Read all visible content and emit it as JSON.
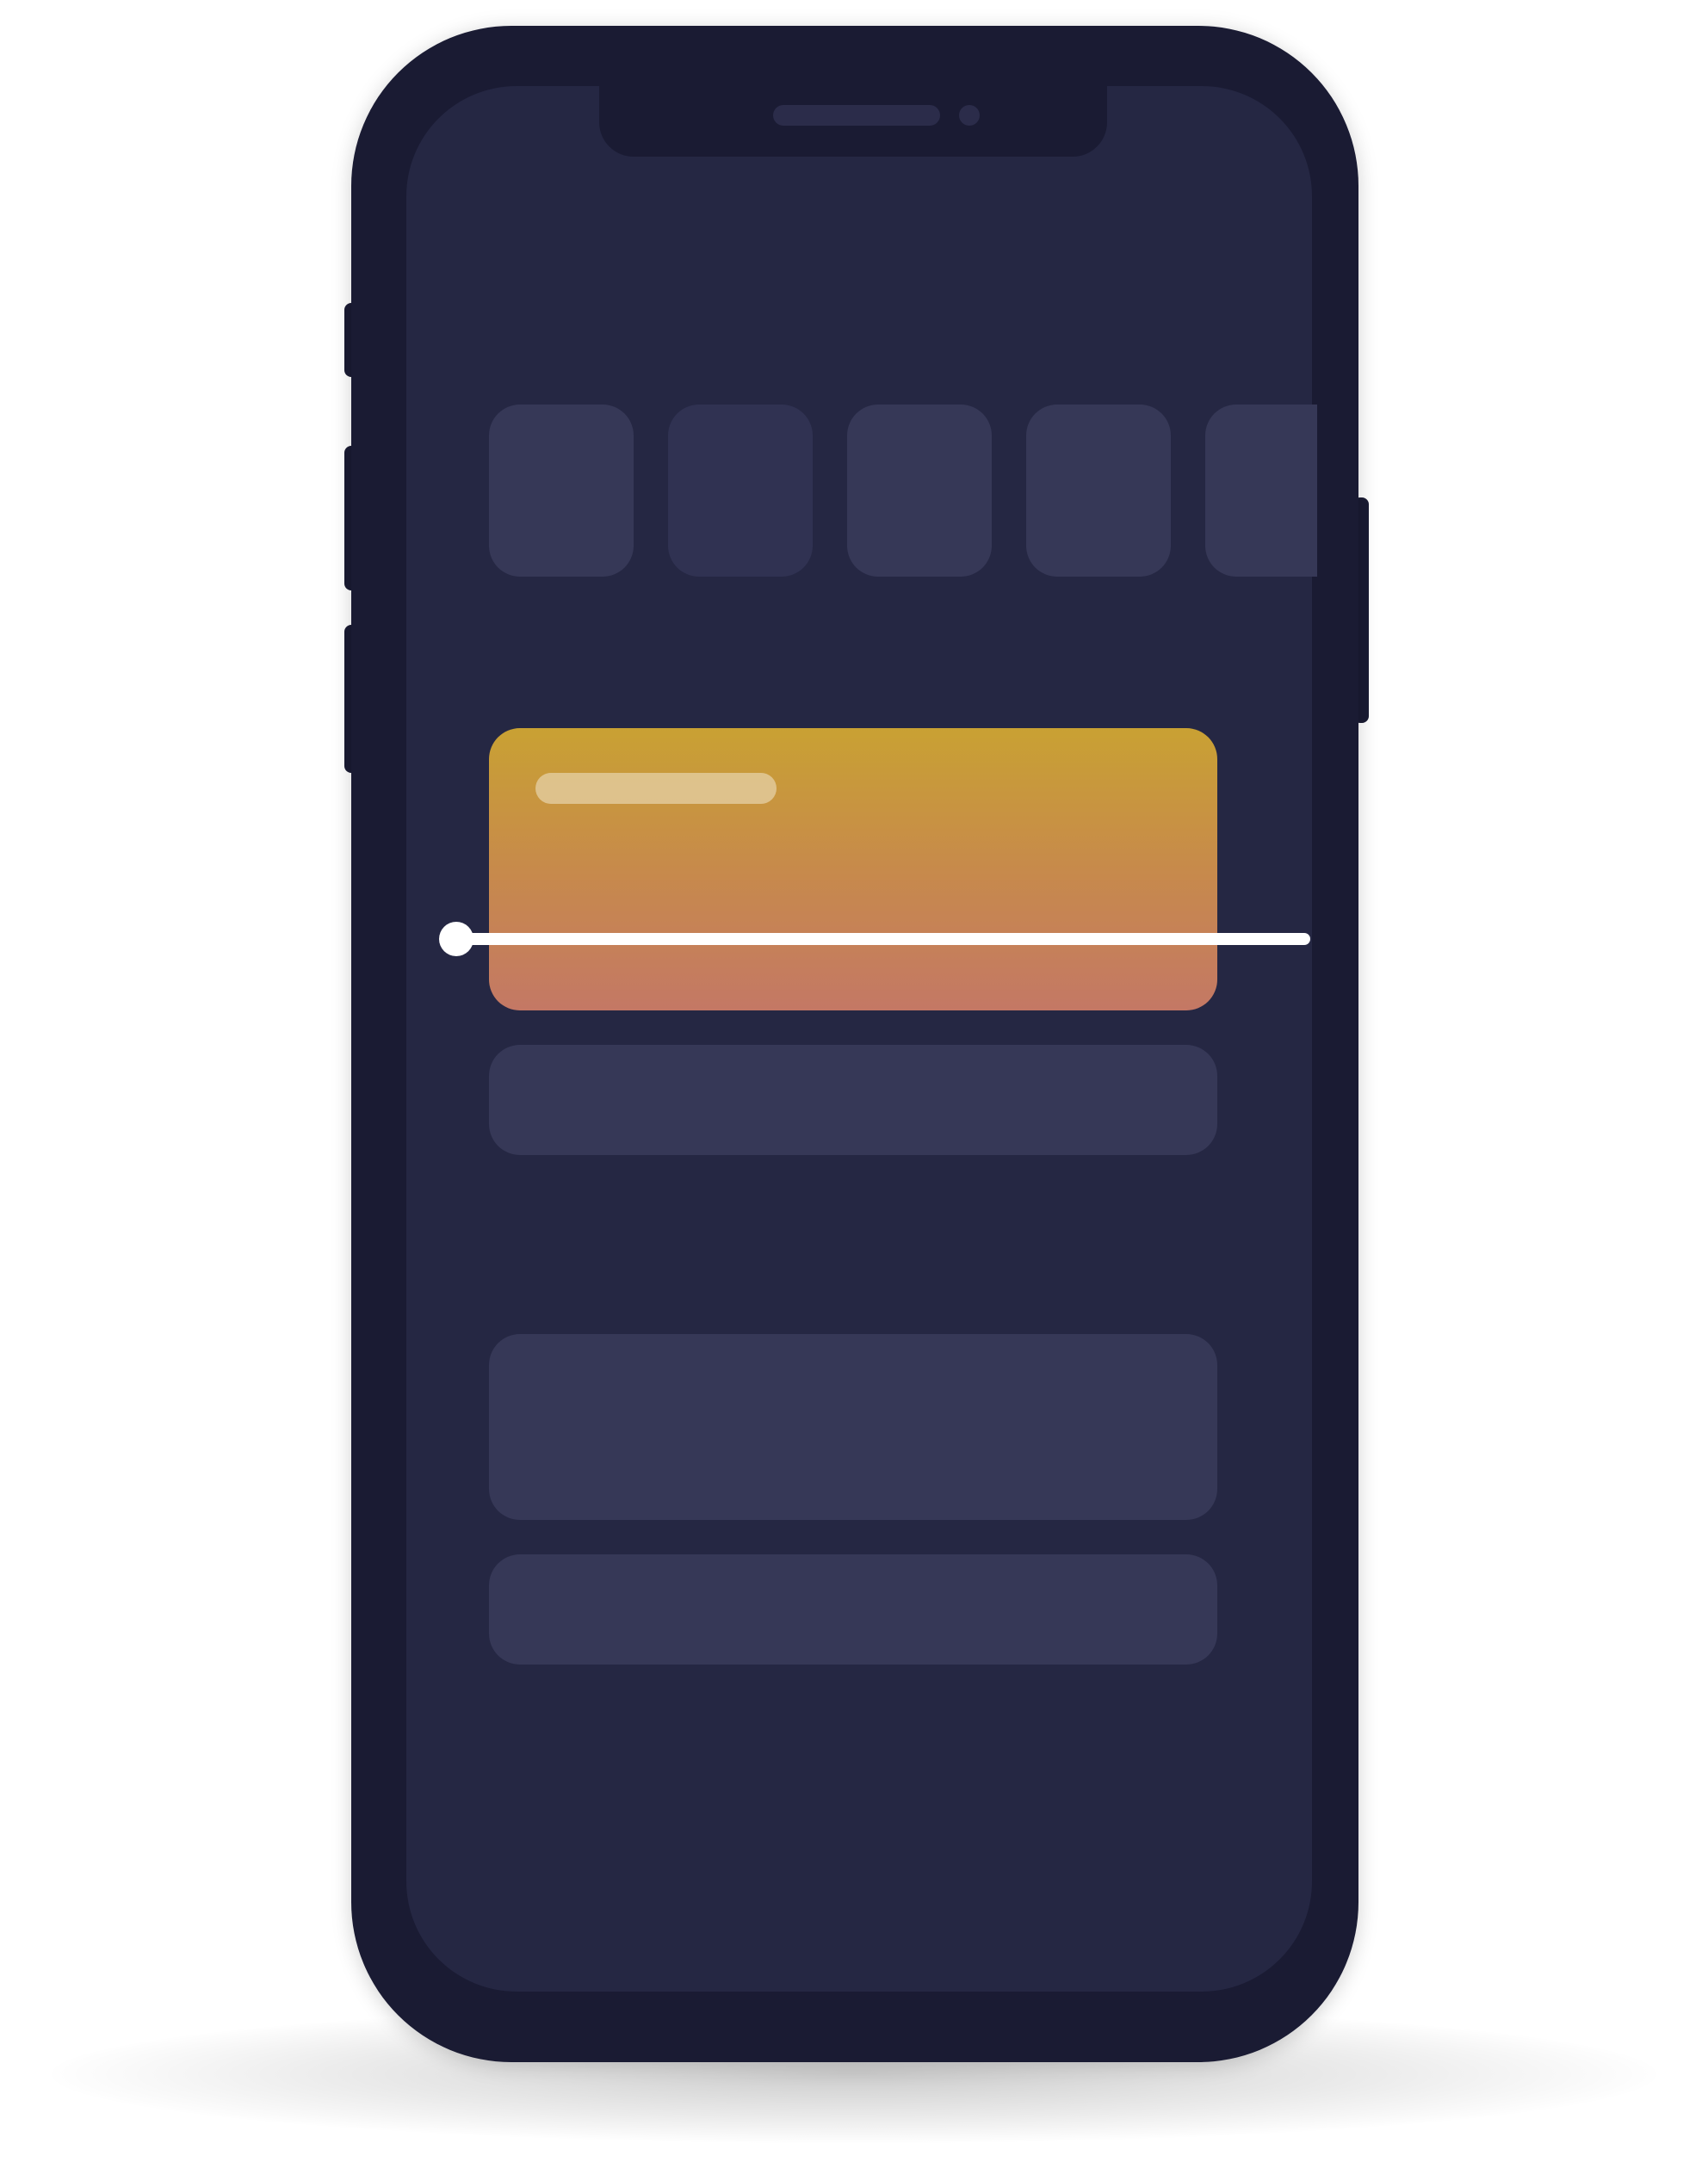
{
  "device": {
    "type": "smartphone-mockup",
    "frame_color": "#1a1b33",
    "screen_color": "#252743",
    "placeholder_color": "#363857"
  },
  "icon_row": {
    "count": 5,
    "icons": [
      "app-tile-icon",
      "app-tile-icon",
      "app-tile-icon",
      "app-tile-icon",
      "app-tile-icon"
    ]
  },
  "highlight_card": {
    "gradient_colors": [
      "#c9a133",
      "#c78a4b",
      "#c47865"
    ]
  },
  "scan_indicator": {
    "color": "#ffffff"
  },
  "content_blocks": {
    "count": 3
  }
}
